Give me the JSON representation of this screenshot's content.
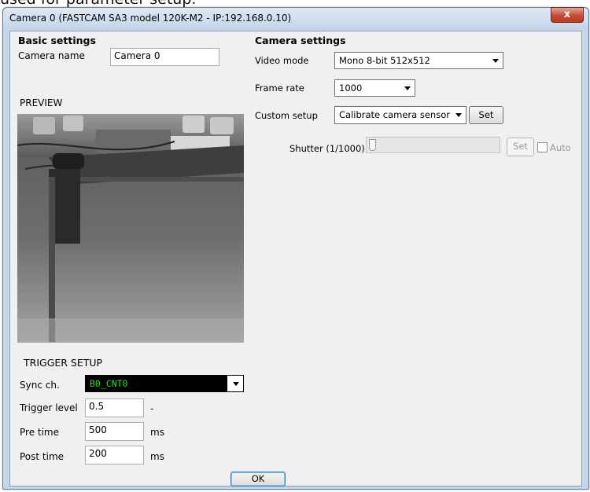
{
  "caption": "used for parameter setup.",
  "window": {
    "title": "Camera  0 (FASTCAM SA3 model 120K-M2 - IP:192.168.0.10)",
    "close_glyph": "x",
    "ok_label": "OK"
  },
  "basic": {
    "heading": "Basic settings",
    "camera_name_label": "Camera name",
    "camera_name_value": "Camera  0",
    "preview_label": "PREVIEW"
  },
  "trigger": {
    "heading": "TRIGGER SETUP",
    "sync_label": "Sync ch.",
    "sync_value": "B0_CNT0",
    "level_label": "Trigger level",
    "level_value": "0.5",
    "level_unit": "-",
    "pre_label": "Pre time",
    "pre_value": "500",
    "pre_unit": "ms",
    "post_label": "Post time",
    "post_value": "200",
    "post_unit": "ms"
  },
  "camera": {
    "heading": "Camera settings",
    "video_mode_label": "Video mode",
    "video_mode_value": "Mono 8-bit 512x512",
    "frame_rate_label": "Frame rate",
    "frame_rate_value": "1000",
    "custom_setup_label": "Custom setup",
    "custom_setup_value": "Calibrate camera sensor",
    "set_label": "Set",
    "shutter_label": "Shutter (1/1000)",
    "shutter_set_label": "Set",
    "auto_label": "Auto",
    "auto_checked": false
  },
  "colors": {
    "sync_field_bg": "#000000",
    "sync_field_text": "#22e322"
  }
}
